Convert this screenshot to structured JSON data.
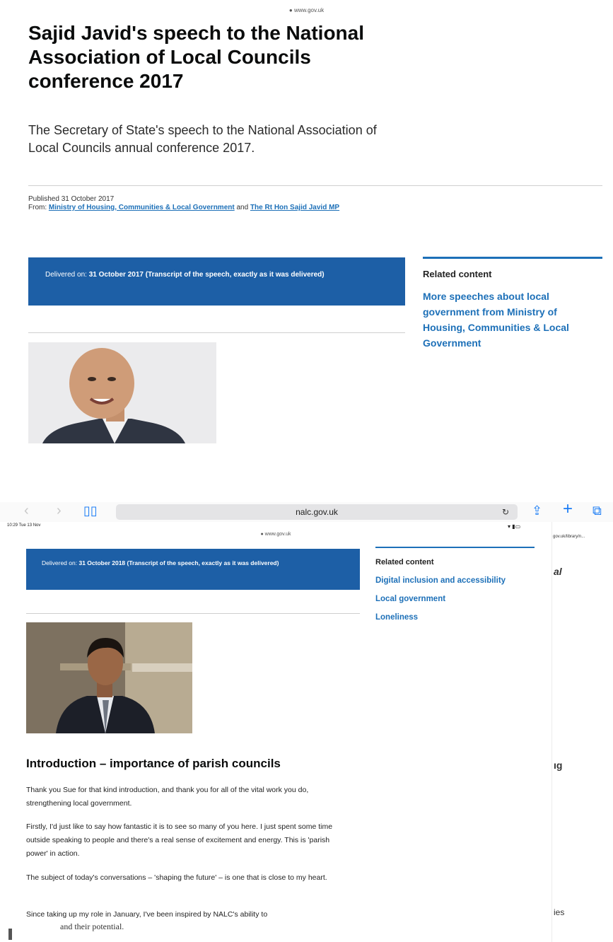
{
  "top": {
    "url": "● www.gov.uk",
    "title": "Sajid Javid's speech to the National Association of Local Councils conference 2017",
    "summary": "The Secretary of State's speech to the National Association of Local Councils annual conference 2017.",
    "published": "Published 31 October 2017",
    "from_label": "From:",
    "from_org": "Ministry of Housing, Communities & Local Government",
    "from_and": "and",
    "from_person": "The Rt Hon Sajid Javid MP",
    "delivered_label": "Delivered on:",
    "delivered_value": "31 October 2017 (Transcript of the speech, exactly as it was delivered)",
    "related_title": "Related content",
    "related_link": "More speeches about local government from Ministry of Housing, Communities & Local Government"
  },
  "browser": {
    "url": "nalc.gov.uk",
    "status_time": "10:29  Tue 13 Nov",
    "inner_url": "● www.gov.uk",
    "right_url": "gov.uk/library/n..."
  },
  "bottom": {
    "delivered_label": "Delivered on:",
    "delivered_value": "31 October 2018 (Transcript of the speech, exactly as it was delivered)",
    "related_title": "Related content",
    "related_links": [
      "Digital inclusion and accessibility",
      "Local government",
      "Loneliness"
    ],
    "heading": "Introduction – importance of parish councils",
    "paragraphs": [
      "Thank you Sue for that kind introduction, and thank you for all of the vital work you do, strengthening local government.",
      "Firstly, I'd just like to say how fantastic it is to see so many of you here. I just spent some time outside speaking to people and there's a real sense of excitement and energy. This is 'parish power' in action.",
      "The subject of today's conversations – 'shaping the future' – is one that is close to my heart.",
      "Since taking up my role in January, I've been inspired by NALC's ability to"
    ],
    "cut_text": "and their potential.",
    "right_fragments": [
      "al",
      "ıg",
      "ies"
    ]
  },
  "colors": {
    "accent_blue": "#1d5fa6",
    "link_blue": "#1d70b8",
    "ios_blue": "#1a7cf5"
  }
}
